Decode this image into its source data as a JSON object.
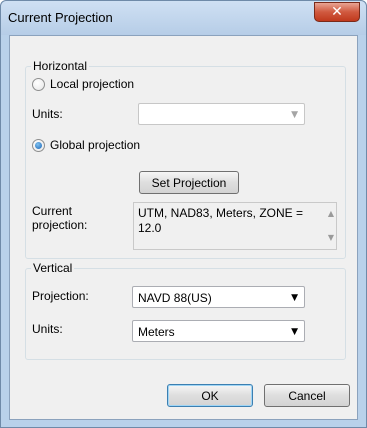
{
  "window": {
    "title": "Current Projection",
    "close_glyph": "✕"
  },
  "horizontal": {
    "group_title": "Horizontal",
    "local_label": "Local projection",
    "units_label": "Units:",
    "units_value": "",
    "global_label": "Global projection",
    "set_projection_label": "Set Projection",
    "current_label_line1": "Current",
    "current_label_line2": "projection:",
    "current_value": "UTM, NAD83, Meters, ZONE = 12.0",
    "selected": "global"
  },
  "vertical": {
    "group_title": "Vertical",
    "projection_label": "Projection:",
    "projection_value": "NAVD 88(US)",
    "units_label": "Units:",
    "units_value": "Meters"
  },
  "buttons": {
    "ok": "OK",
    "cancel": "Cancel"
  },
  "icons": {
    "dropdown": "triangle-down",
    "close": "x-mark",
    "scroll": "triangle-up-down"
  }
}
